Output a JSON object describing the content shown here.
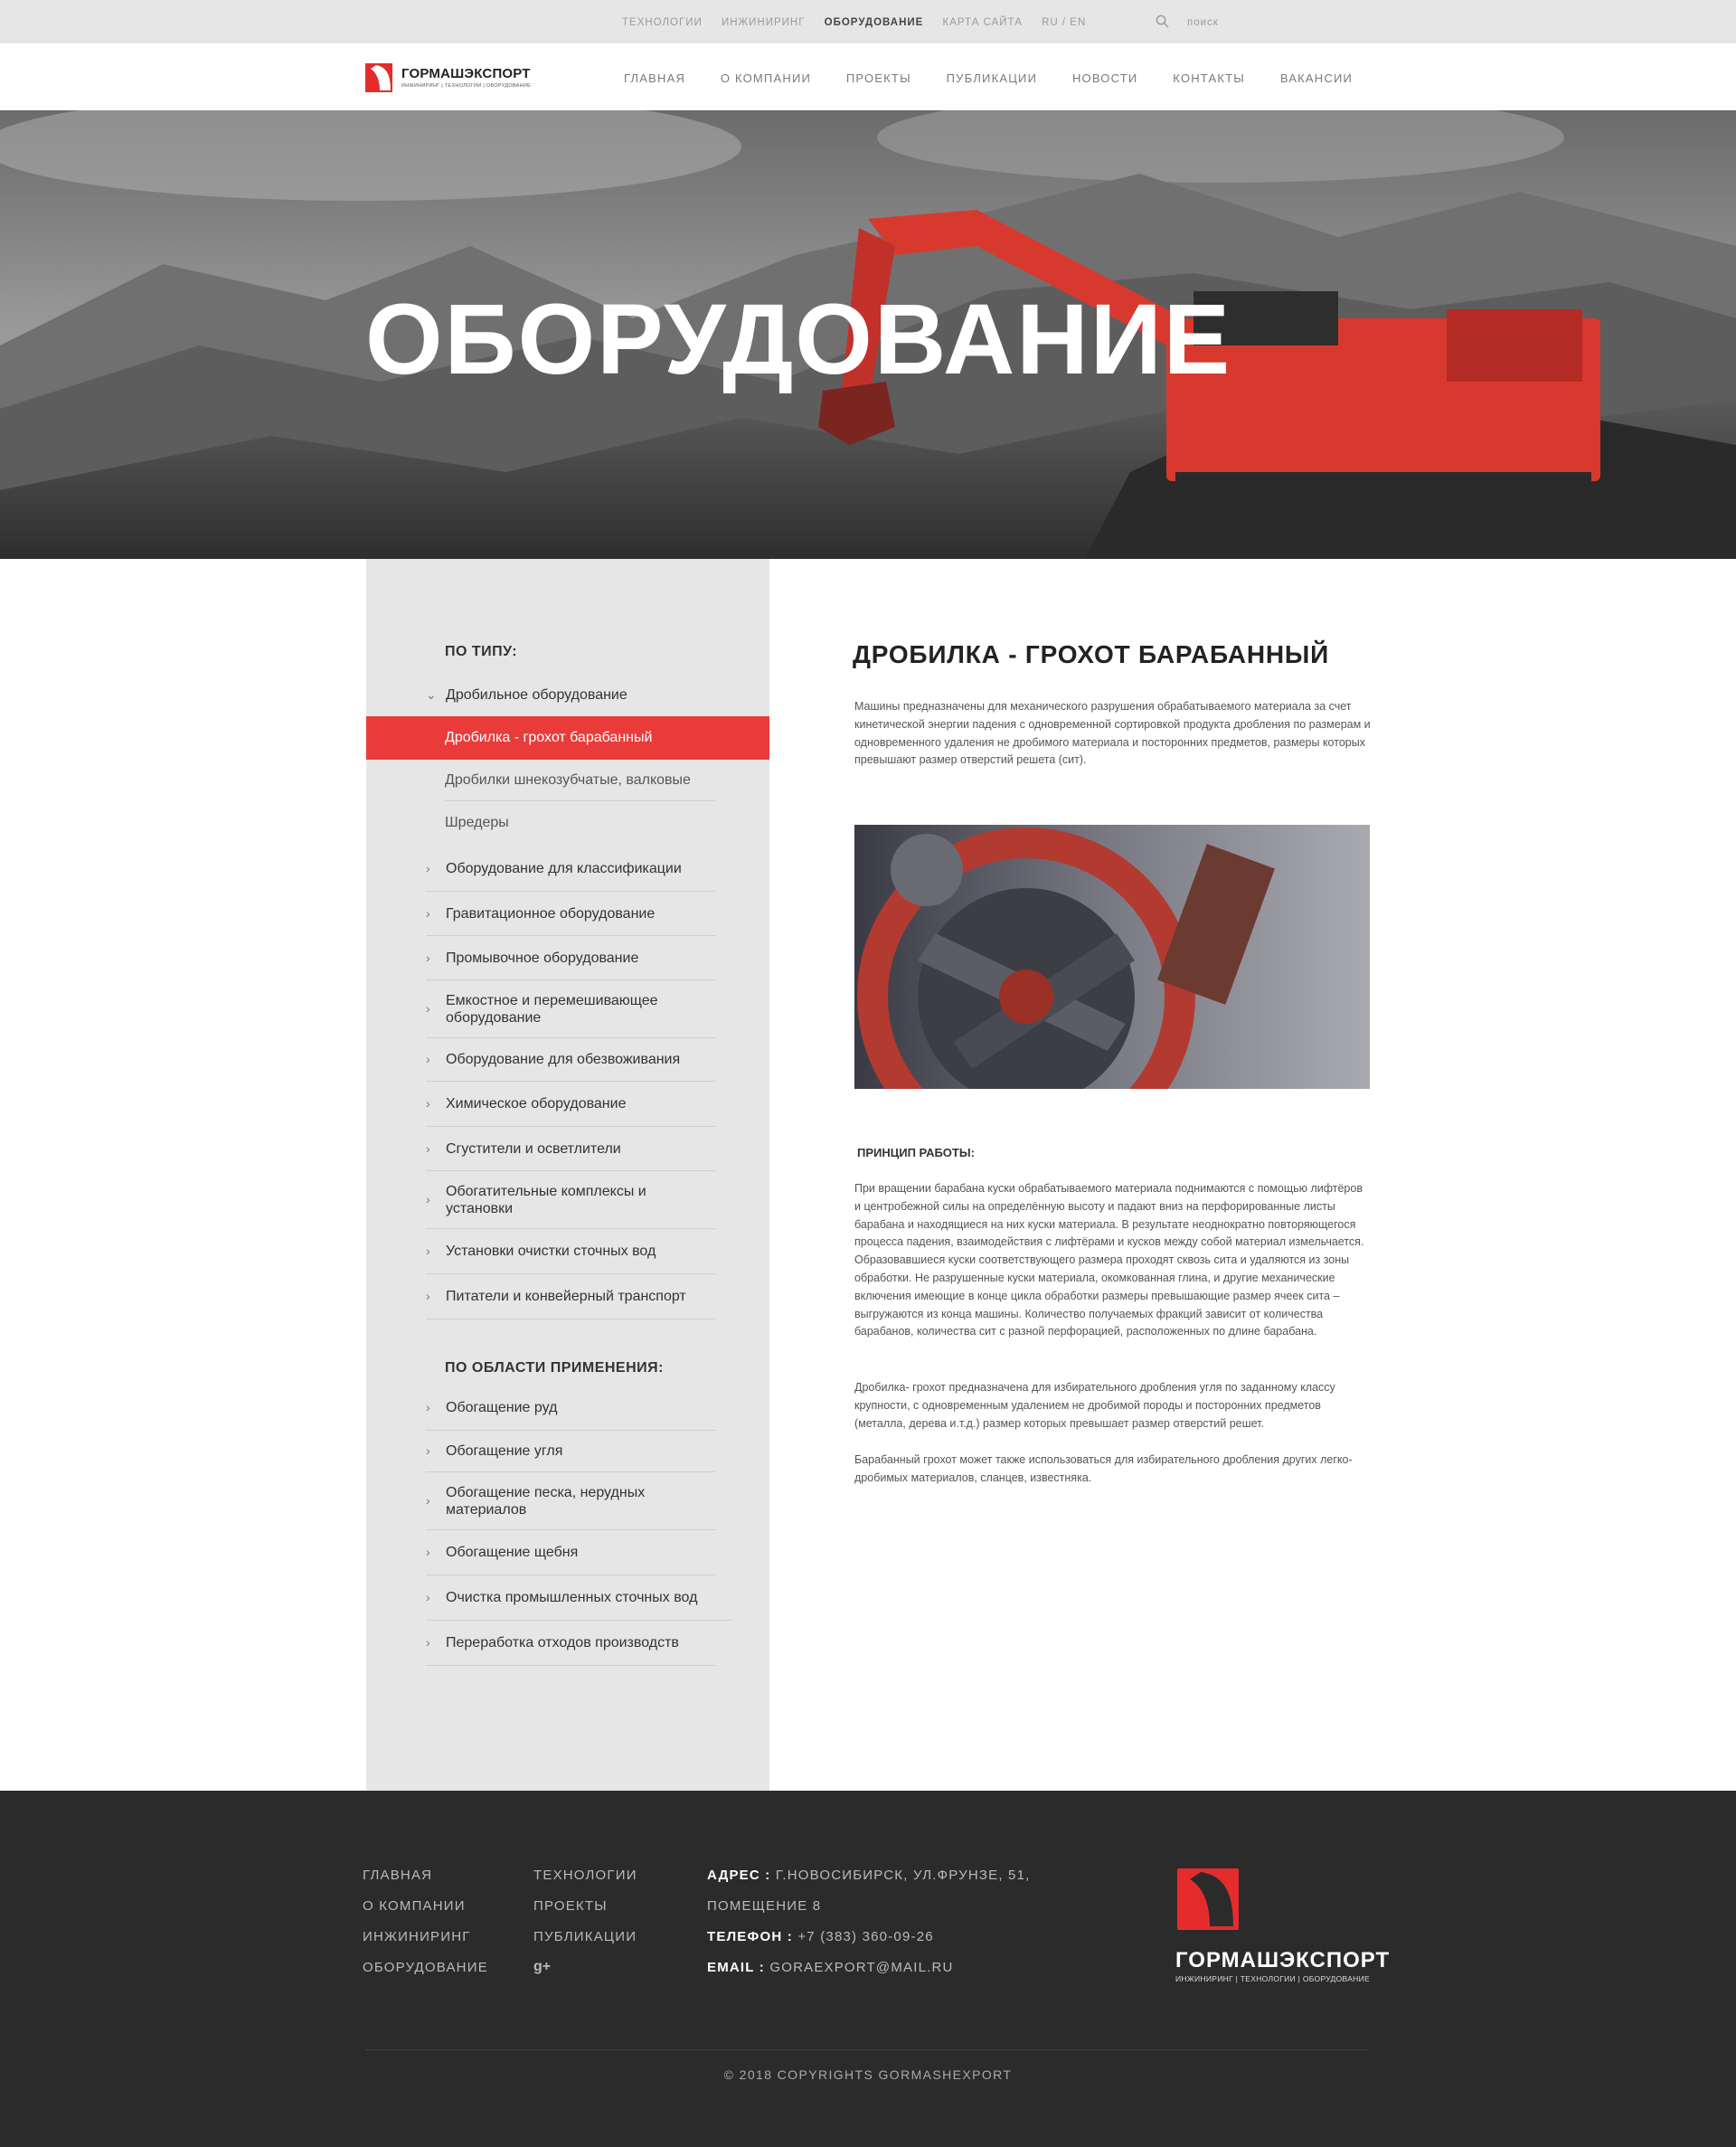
{
  "topbar": {
    "links": [
      "Технологии",
      "Инжиниринг",
      "Оборудование",
      "Карта сайта",
      "RU / EN"
    ],
    "active": "Оборудование",
    "search_label": "поиск"
  },
  "header": {
    "brand": "ГОРМАШЭКСПОРТ",
    "tagline": "ИНЖИНИРИНГ | ТЕХНОЛОГИИ | ОБОРУДОВАНИЕ",
    "nav": [
      "Главная",
      "О компании",
      "Проекты",
      "Публикации",
      "Новости",
      "Контакты",
      "Вакансии"
    ]
  },
  "hero": {
    "title": "Оборудование"
  },
  "sidebar": {
    "by_type_heading": "По типу:",
    "by_type": [
      "Дробильное оборудование",
      "Дробилка - грохот барабанный",
      "Дробилки шнекозубчатые, валковые",
      "Шредеры",
      "Оборудование для классификации",
      "Гравитационное оборудование",
      "Промывочное оборудование",
      "Емкостное и перемешивающее оборудование",
      "Оборудование для обезвоживания",
      "Химическое оборудование",
      "Сгустители и осветлители",
      "Обогатительные комплексы и установки",
      "Установки очистки сточных вод",
      "Питатели и конвейерный транспорт"
    ],
    "by_area_heading": "По области применения:",
    "by_area": [
      "Обогащение руд",
      "Обогащение угля",
      "Обогащение песка, нерудных материалов",
      "Обогащение щебня",
      "Очистка промышленных сточных вод",
      "Переработка отходов производств"
    ]
  },
  "content": {
    "title": "Дробилка - грохот барабанный",
    "intro": "Машины предназначены для механического разрушения обрабатываемого материала за счет кинетической энергии падения с одновременной сортировкой продукта дробления по размерам и одновременного удаления не дробимого материала и посторонних предметов, размеры которых превышают размер отверстий решета (сит).",
    "principle_heading": "Принцип работы:",
    "principle_text": "При вращении барабана куски обрабатываемого материала поднимаются с помощью лифтёров и центробежной силы на определённую высоту и падают вниз на перфорированные листы барабана и находящиеся на них куски материала. В результате неоднократно повторяющегося процесса падения, взаимодействия с лифтёрами и кусков между собой материал измельчается. Образовавшиеся куски соответствующего размера проходят сквозь сита и удаляются из зоны обработки. Не разрушенные куски материала, окомкованная глина, и другие механические включения имеющие в конце цикла обработки размеры превышающие размер ячеек сита – выгружаются из конца машины. Количество получаемых фракций зависит от количества барабанов, количества сит с разной перфорацией, расположенных по длине барабана.",
    "purpose_text": "Дробилка- грохот  предназначена для избирательного дробления угля по заданному классу крупности, с одновременным удалением не дробимой породы и посторонних предметов (металла, дерева и.т.д.) размер которых превышает размер отверстий решет.",
    "extra_text": "Барабанный грохот  может также использоваться для избирательного дробления других легко-дробимых материалов, сланцев, известняка."
  },
  "footer": {
    "col1": [
      "Главная",
      "О компании",
      "Инжиниринг",
      "Оборудование"
    ],
    "col2": [
      "Технологии",
      "Проекты",
      "Публикации"
    ],
    "address_label": "Адрес :",
    "address": "г.Новосибирск, ул.Фрунзе, 51,",
    "address2": "помещение 8",
    "phone_label": "Телефон :",
    "phone": "+7 (383) 360-09-26",
    "email_label": "Email :",
    "email": "goraexport@mail.ru",
    "brand": "ГОРМАШЭКСПОРТ",
    "tagline": "ИНЖИНИРИНГ | ТЕХНОЛОГИИ | ОБОРУДОВАНИЕ",
    "copyright": "© 2018 Copyrights GORMASHEXPORT",
    "gplus": "g+"
  },
  "colors": {
    "accent": "#ea3b3b",
    "sidebar_bg": "#e6e6e6",
    "footer_bg": "#2b2b2b"
  }
}
